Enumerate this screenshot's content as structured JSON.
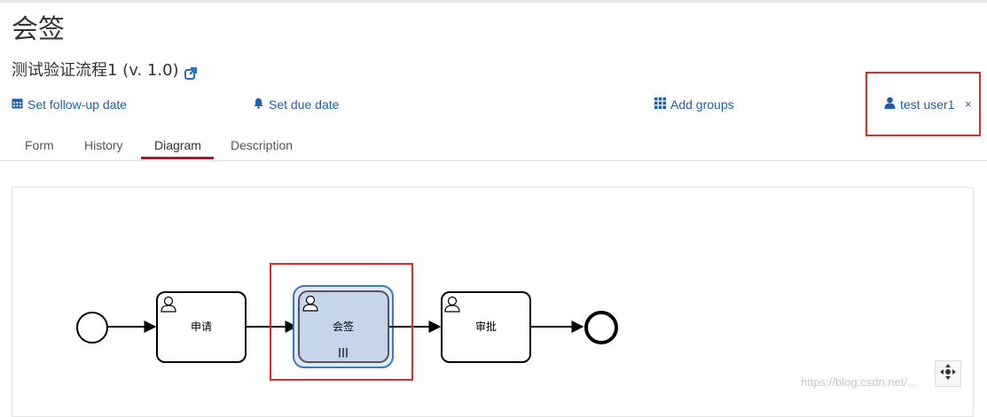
{
  "task": {
    "title": "会签",
    "process": "测试验证流程1 (v. 1.0)"
  },
  "actions": {
    "follow_up": "Set follow-up date",
    "due_date": "Set due date",
    "add_groups": "Add groups",
    "assignee": "test user1",
    "remove_assignee": "×"
  },
  "tabs": [
    "Form",
    "History",
    "Diagram",
    "Description"
  ],
  "active_tab": "Diagram",
  "diagram": {
    "tasks": [
      "申请",
      "会签",
      "审批"
    ],
    "highlighted_task": "会签",
    "multi_instance_marker": "|||"
  },
  "colors": {
    "link": "#1f5fa8",
    "active_tab_underline": "#b0152b",
    "highlight_fill": "#c6d5ec",
    "highlight_border": "#3f78c2",
    "annotation_box": "#e32a2a"
  },
  "watermark": "https://blog.csdn.net/..."
}
